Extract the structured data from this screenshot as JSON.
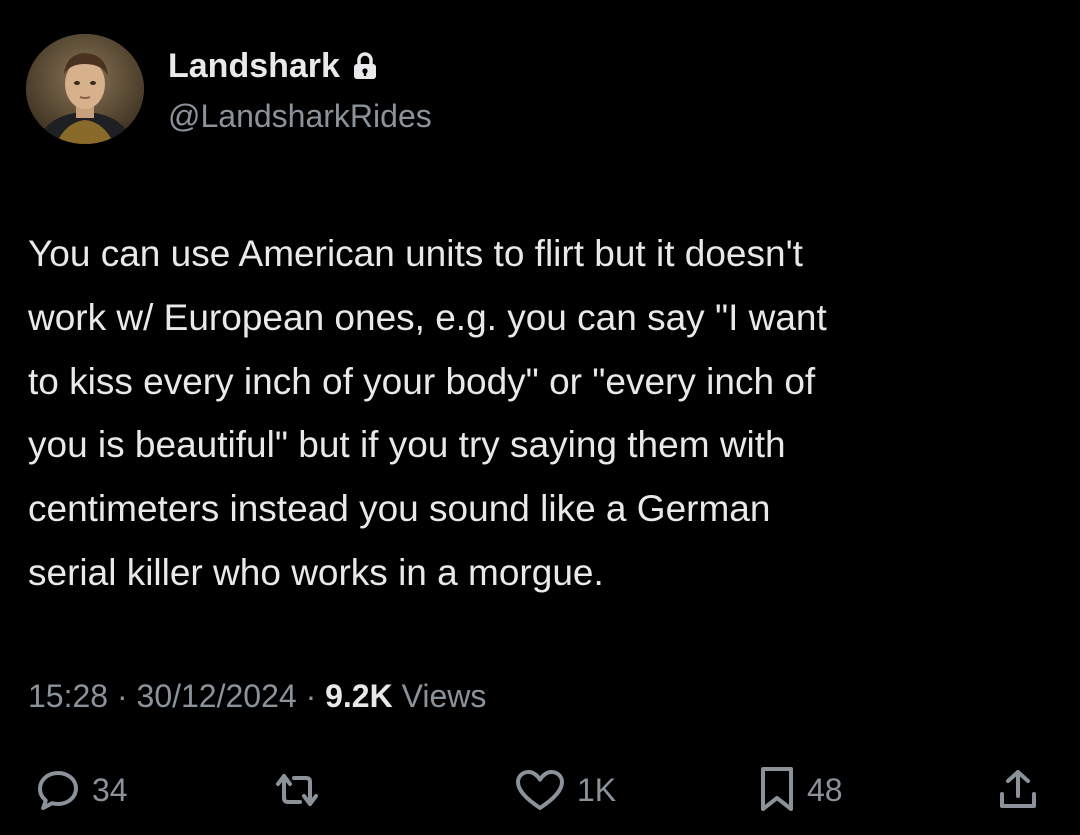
{
  "user": {
    "display_name": "Landshark",
    "handle": "@LandsharkRides",
    "protected_icon": "lock-icon",
    "avatar_icon": "portrait-avatar"
  },
  "tweet": {
    "lines": [
      "You can use American units to flirt but it doesn't",
      "work w/ European ones, e.g. you can say \"I want",
      "to kiss every inch of your body\" or \"every inch of",
      "you is beautiful\" but if you try saying them with",
      "centimeters instead you sound like a German",
      "serial killer who works in a morgue."
    ]
  },
  "meta": {
    "time": "15:28",
    "separator": " · ",
    "date": "30/12/2024",
    "views_count": "9.2K",
    "views_label": " Views"
  },
  "actions": {
    "reply": {
      "icon": "reply-icon",
      "count": "34"
    },
    "retweet": {
      "icon": "retweet-icon",
      "count": ""
    },
    "like": {
      "icon": "heart-icon",
      "count": "1K"
    },
    "bookmark": {
      "icon": "bookmark-icon",
      "count": "48"
    },
    "share": {
      "icon": "share-icon"
    }
  },
  "colors": {
    "background": "#000000",
    "primary_text": "#e7e9ea",
    "secondary_text": "#8b9299"
  }
}
